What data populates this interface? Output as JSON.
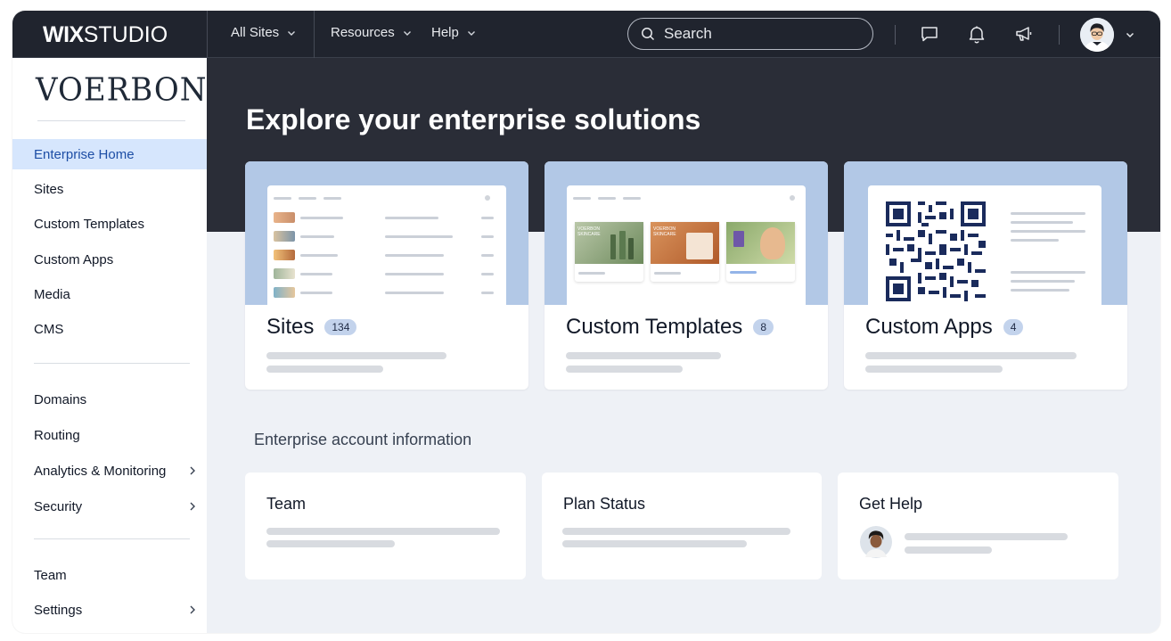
{
  "topbar": {
    "logo_bold": "WIX",
    "logo_thin": "STUDIO",
    "nav": [
      {
        "label": "All Sites"
      },
      {
        "label": "Resources"
      },
      {
        "label": "Help"
      }
    ],
    "search_placeholder": "Search",
    "icons": [
      "chat-icon",
      "bell-icon",
      "megaphone-icon"
    ]
  },
  "sidebar": {
    "brand": "VOERBON",
    "items": [
      {
        "label": "Enterprise Home",
        "active": true
      },
      {
        "label": "Sites"
      },
      {
        "label": "Custom Templates"
      },
      {
        "label": "Custom Apps"
      },
      {
        "label": "Media"
      },
      {
        "label": "CMS"
      },
      {
        "label": "Domains"
      },
      {
        "label": "Routing"
      },
      {
        "label": "Analytics & Monitoring",
        "has_submenu": true
      },
      {
        "label": "Security",
        "has_submenu": true
      },
      {
        "label": "Team"
      },
      {
        "label": "Settings",
        "has_submenu": true
      }
    ]
  },
  "main": {
    "title": "Explore your enterprise solutions",
    "cards": [
      {
        "title": "Sites",
        "count": "134"
      },
      {
        "title": "Custom Templates",
        "count": "8",
        "preview_texts": [
          "VOERBON SKINCARE",
          "VOERBON SKINCARE"
        ]
      },
      {
        "title": "Custom Apps",
        "count": "4"
      }
    ],
    "section_title": "Enterprise account information",
    "info_cards": [
      {
        "title": "Team"
      },
      {
        "title": "Plan Status"
      },
      {
        "title": "Get Help"
      }
    ]
  },
  "colors": {
    "topbar_bg": "#20242e",
    "hero_bg": "#2a2d37",
    "accent_active": "#d6e6fd",
    "card_top": "#b2c8e6",
    "badge": "#c3d3ec"
  }
}
